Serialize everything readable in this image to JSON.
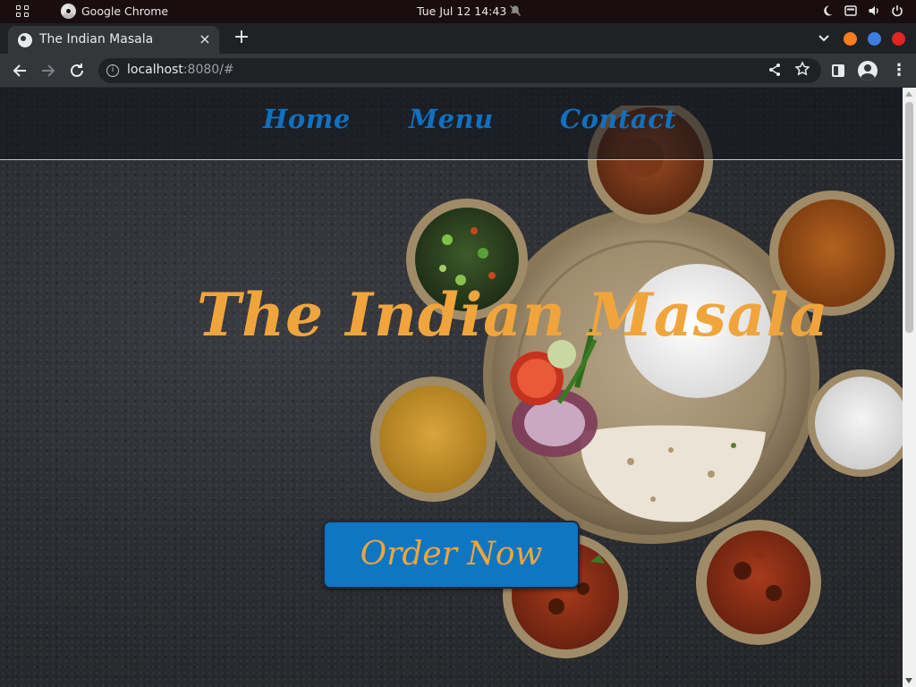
{
  "os": {
    "app_name": "Google Chrome",
    "clock": "Tue Jul 12  14:43"
  },
  "browser": {
    "tab_title": "The Indian Masala",
    "tab_close": "×",
    "new_tab": "+",
    "url_host": "localhost",
    "url_rest": ":8080/#",
    "window_buttons": {
      "minimize_color": "#f57c1f",
      "maximize_color": "#3b7de1",
      "close_color": "#e0261f"
    }
  },
  "site": {
    "nav": {
      "home": "Home",
      "menu": "Menu",
      "contact": "Contact"
    },
    "hero_title": "The Indian Masala",
    "order_button": "Order Now",
    "colors": {
      "nav_link": "#1171c0",
      "title": "#f0a53c",
      "button_bg": "#0f76c2"
    }
  }
}
